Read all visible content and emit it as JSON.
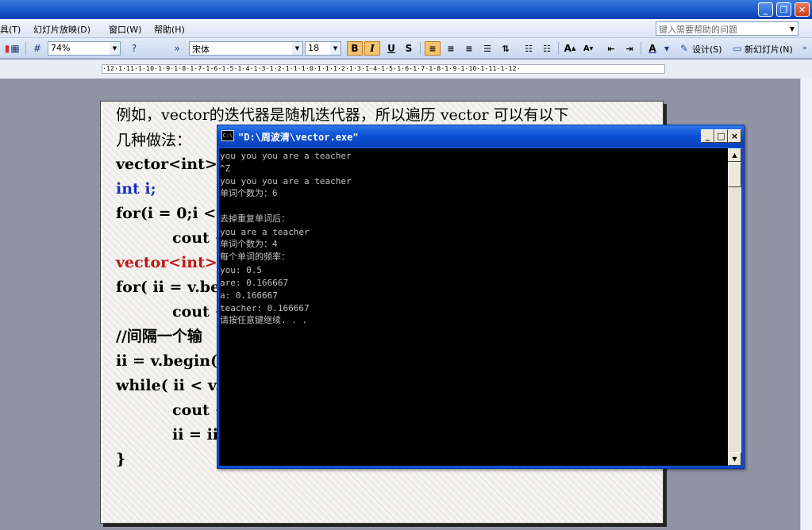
{
  "titlebar": {
    "minimize": "_",
    "restore": "❐",
    "close": "✕"
  },
  "menubar": {
    "items": [
      "具(T)",
      "幻灯片放映(D)",
      "窗口(W)",
      "帮助(H)"
    ],
    "help_placeholder": "键入需要帮助的问题"
  },
  "toolbar": {
    "zoom": "74%",
    "font": "宋体",
    "size": "18",
    "bold": "B",
    "italic": "I",
    "underline": "U",
    "shadow": "S",
    "design_label": "设计(S)",
    "new_slide_label": "新幻灯片(N)"
  },
  "ruler": {
    "text": "·12·1·11·1·10·1·9·1·8·1·7·1·6·1·5·1·4·1·3·1·2·1·1·1·0·1·1·1·2·1·3·1·4·1·5·1·6·1·7·1·8·1·9·1·10·1·11·1·12·"
  },
  "slide": {
    "lines": [
      "例如，vector的迭代器是随机迭代器，所以遍历 vector 可以有以下",
      "几种做法：",
      "vector<int>",
      "int i;",
      "for(i = 0;i < v",
      "cout <",
      "vector<int>:",
      "for( ii = v.be",
      "cout <",
      "//间隔一个输",
      "ii = v.begin()",
      "while( ii < v.",
      "cout <",
      "ii = ii",
      "}"
    ]
  },
  "console": {
    "title": "\"D:\\周波清\\vector.exe\"",
    "icon_label": "C:\\",
    "min": "_",
    "max": "□",
    "close": "×",
    "lines": [
      "you you you are a teacher",
      "^Z",
      "you you you are a teacher",
      "单词个数为：6",
      "",
      "去掉重复单词后：",
      "you are a teacher",
      "单词个数为：4",
      "每个单词的频率：",
      "you:  0.5",
      "are:  0.166667",
      "a:  0.166667",
      "teacher:  0.166667",
      "请按任意键继续. . ."
    ],
    "scroll_up": "▲",
    "scroll_down": "▼"
  }
}
